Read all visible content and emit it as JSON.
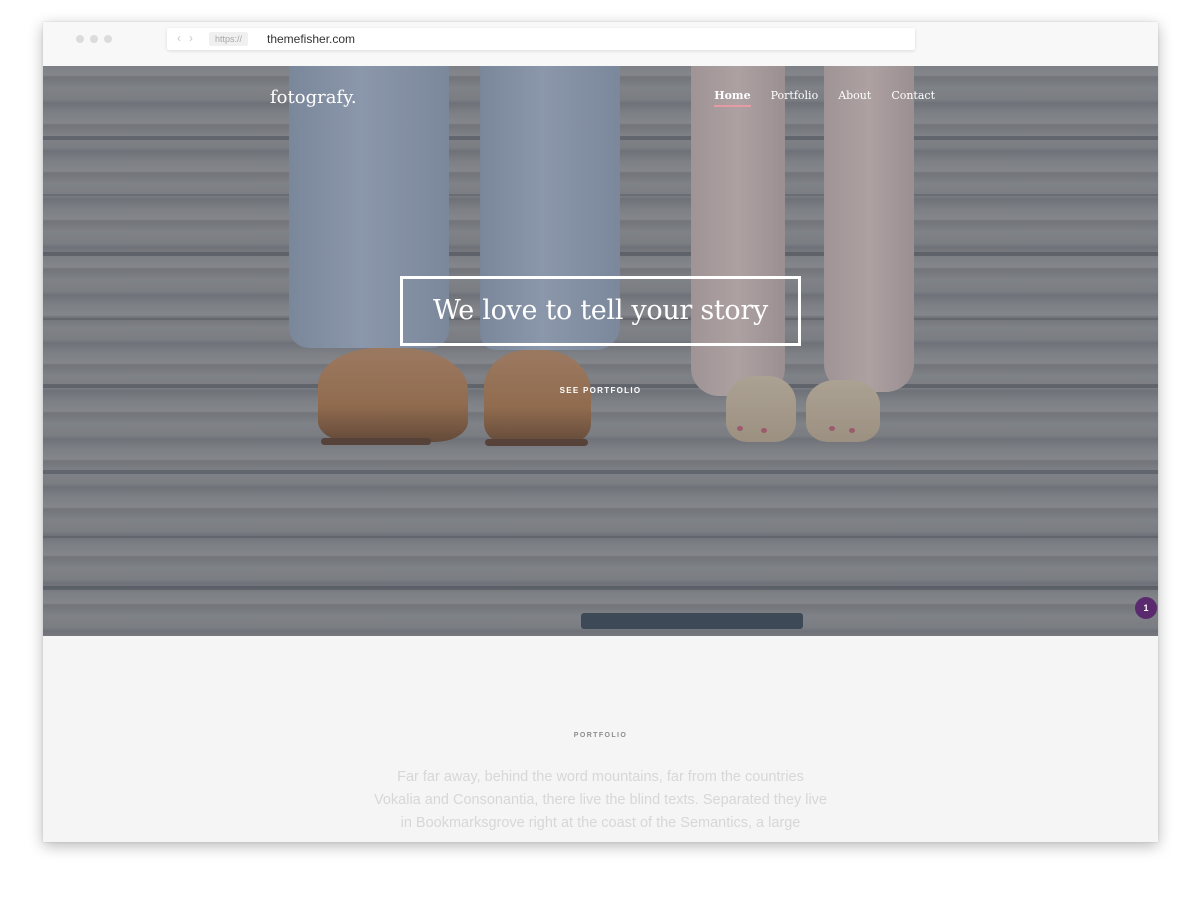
{
  "browser": {
    "protocol": "https://",
    "url": "themefisher.com",
    "back_icon": "chevron-left-icon",
    "forward_icon": "chevron-right-icon"
  },
  "site": {
    "logo": "fotografy.",
    "nav": [
      {
        "label": "Home",
        "active": true
      },
      {
        "label": "Portfolio",
        "active": false
      },
      {
        "label": "About",
        "active": false
      },
      {
        "label": "Contact",
        "active": false
      }
    ]
  },
  "hero": {
    "headline": "We love to tell your story",
    "cta": "SEE PORTFOLIO",
    "badge": "1"
  },
  "portfolio": {
    "label": "PORTFOLIO",
    "text": "Far far away, behind the word mountains, far from the countries Vokalia and Consonantia, there live the blind texts. Separated they live in Bookmarksgrove right at the coast of the Semantics, a large"
  },
  "colors": {
    "accent_underline": "#e69aa3",
    "badge": "#5b2a6e",
    "section_bg": "#f5f5f5"
  }
}
